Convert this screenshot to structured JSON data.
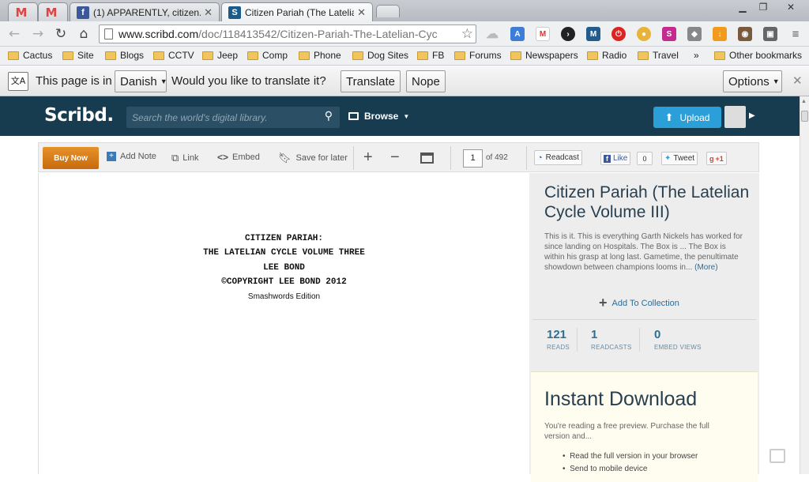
{
  "tabs": [
    {
      "title": "",
      "icon": "gmail-icon"
    },
    {
      "title": "",
      "icon": "gmail-icon"
    },
    {
      "title": "(1) APPARENTLY, citizen...",
      "icon": "facebook-icon"
    },
    {
      "title": "Citizen Pariah (The Latelia",
      "icon": "scribd-icon"
    }
  ],
  "omnibox": {
    "domain": "www.scribd.com",
    "path": "/doc/118413542/Citizen-Pariah-The-Latelian-Cyc"
  },
  "bookmarks": [
    "Cactus",
    "Site",
    "Blogs",
    "CCTV",
    "Jeep",
    "Comp",
    "Phone",
    "Dog Sites",
    "FB",
    "Forums",
    "Newspapers",
    "Radio",
    "Travel"
  ],
  "bookmarks_more": "»",
  "other_bookmarks": "Other bookmarks",
  "translate": {
    "prefix": "This page is in",
    "language": "Danish",
    "question": "Would you like to translate it?",
    "translate_btn": "Translate",
    "nope_btn": "Nope",
    "options_btn": "Options"
  },
  "scribd": {
    "logo": "Scribd.",
    "search_placeholder": "Search the world's digital library.",
    "browse": "Browse",
    "upload": "Upload"
  },
  "doc_toolbar": {
    "buy_now": "Buy Now",
    "add_note": "Add Note",
    "link": "Link",
    "embed": "Embed",
    "save_later": "Save for later",
    "page_current": "1",
    "page_total": "of 492",
    "readcast": "Readcast",
    "like": "Like",
    "like_count": "0",
    "tweet": "Tweet",
    "plus_one": "+1"
  },
  "page_text": [
    "CITIZEN PARIAH:",
    "THE LATELIAN CYCLE VOLUME THREE",
    "LEE BOND",
    "©COPYRIGHT LEE BOND 2012"
  ],
  "page_edition": "Smashwords Edition",
  "sidebar": {
    "title": "Citizen Pariah (The Latelian Cycle Volume III)",
    "description": "This is it. This is everything Garth Nickels has worked for since landing on Hospitals. The Box is ... The Box is within his grasp at long last. Gametime, the penultimate showdown between champions looms in...",
    "more": "(More)",
    "add_collection": "Add To Collection",
    "stats": [
      {
        "value": "121",
        "label": "READS"
      },
      {
        "value": "1",
        "label": "READCASTS"
      },
      {
        "value": "0",
        "label": "EMBED VIEWS"
      }
    ],
    "instant_title": "Instant Download",
    "instant_text": "You're reading a free preview. Purchase the full version and...",
    "instant_items": [
      "Read the full version in your browser",
      "Send to mobile device"
    ]
  },
  "colors": {
    "scribd_header": "#173c50",
    "upload": "#2a9fd8",
    "buy_now": "#d97d1a"
  }
}
